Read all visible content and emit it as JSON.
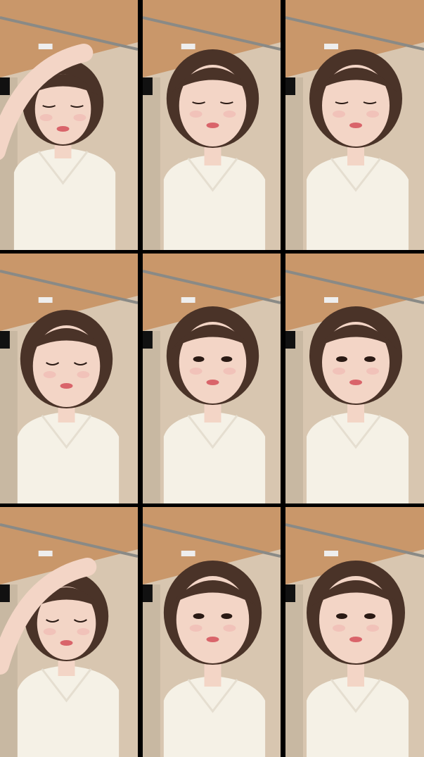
{
  "grid": {
    "rows": 3,
    "cols": 3,
    "tiles": [
      {
        "pose": "hand-on-head"
      },
      {
        "pose": "eyes-closed-speaking"
      },
      {
        "pose": "eyes-closed-smiling"
      },
      {
        "pose": "head-tilt-speaking"
      },
      {
        "pose": "smiling-braces"
      },
      {
        "pose": "smiling"
      },
      {
        "pose": "looking-down-hand"
      },
      {
        "pose": "speaking-close"
      },
      {
        "pose": "close-up"
      }
    ]
  },
  "colors": {
    "ceiling": "#c9976a",
    "wall": "#d8c6b0",
    "hair": "#4a3328",
    "skin": "#f3d5c6",
    "shirt": "#f5f1e6"
  }
}
